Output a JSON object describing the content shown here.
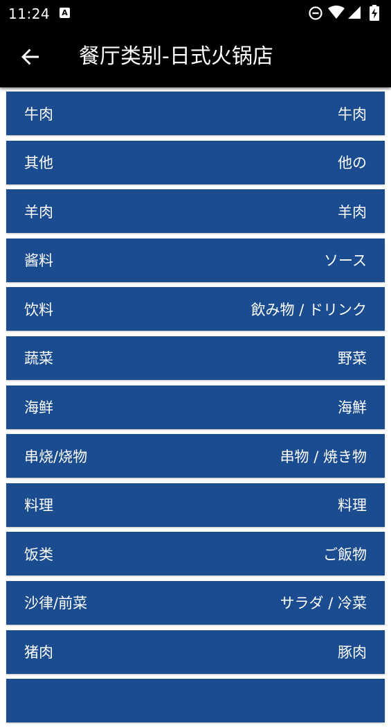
{
  "status_bar": {
    "time": "11:24",
    "notification_icon_letter": "A",
    "icons": [
      "do-not-disturb-icon",
      "wifi-icon",
      "cell-signal-icon",
      "battery-charging-icon"
    ]
  },
  "app_bar": {
    "title": "餐厅类别-日式火锅店",
    "back_icon": "arrow-left-icon"
  },
  "colors": {
    "row_background": "#1c4c90",
    "app_bar_background": "#000000",
    "text": "#ffffff"
  },
  "categories": [
    {
      "cn": "牛肉",
      "jp": "牛肉"
    },
    {
      "cn": "其他",
      "jp": "他の"
    },
    {
      "cn": "羊肉",
      "jp": "羊肉"
    },
    {
      "cn": "酱料",
      "jp": "ソース"
    },
    {
      "cn": "饮料",
      "jp": "飲み物 / ドリンク"
    },
    {
      "cn": "蔬菜",
      "jp": "野菜"
    },
    {
      "cn": "海鲜",
      "jp": "海鮮"
    },
    {
      "cn": "串烧/烧物",
      "jp": "串物 / 焼き物"
    },
    {
      "cn": "料理",
      "jp": "料理"
    },
    {
      "cn": "饭类",
      "jp": "ご飯物"
    },
    {
      "cn": "沙律/前菜",
      "jp": "サラダ / 冷菜"
    },
    {
      "cn": "猪肉",
      "jp": "豚肉"
    },
    {
      "cn": "",
      "jp": ""
    }
  ]
}
